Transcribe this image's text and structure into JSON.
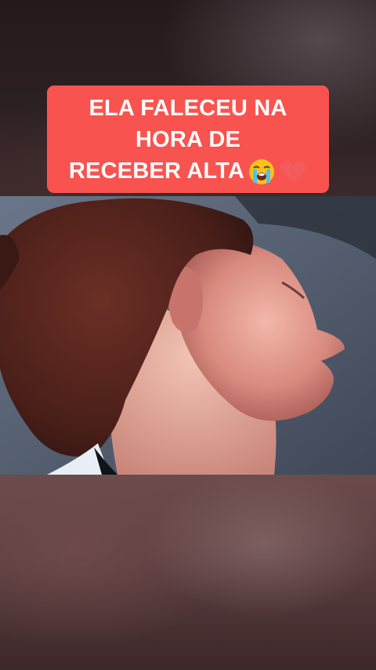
{
  "caption": {
    "line1": "ELA FALECEU NA",
    "line2": "HORA DE",
    "line3": "RECEBER ALTA",
    "emojis": [
      "loudly-crying-face-icon",
      "broken-heart-icon"
    ]
  },
  "colors": {
    "caption_background": "#f8534f",
    "caption_text": "#ffffff"
  }
}
